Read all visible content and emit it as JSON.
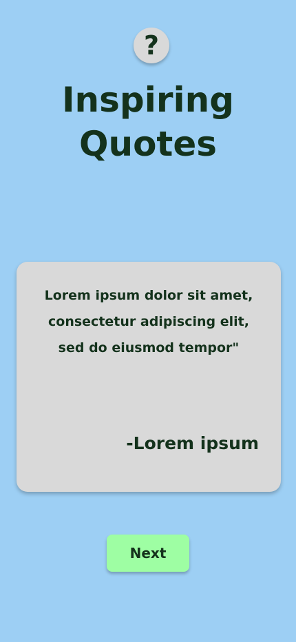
{
  "help_button": {
    "label": "?",
    "icon": "question-mark-icon"
  },
  "header": {
    "title_line1": "Inspiring",
    "title_line2": "Quotes"
  },
  "quote_card": {
    "line1": "Lorem ipsum dolor sit amet,",
    "line2": "consectetur adipiscing elit,",
    "line3": "sed do eiusmod tempor\"",
    "author": "-Lorem ipsum"
  },
  "actions": {
    "next_label": "Next"
  },
  "colors": {
    "background": "#9dcff4",
    "card": "#d9d9d9",
    "text": "#14321c",
    "next_button": "#9efea3",
    "help_button": "#d9d9d9"
  }
}
